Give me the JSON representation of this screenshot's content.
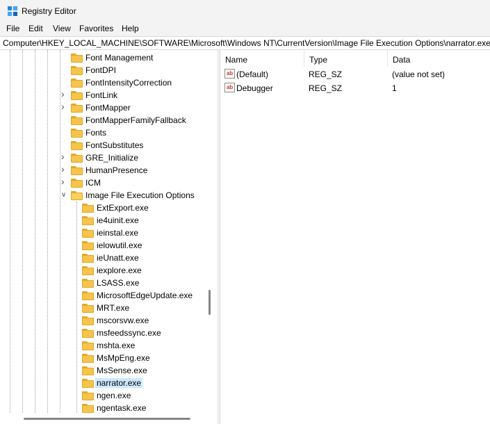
{
  "window": {
    "title": "Registry Editor",
    "app_icon": "regedit-icon"
  },
  "menu": [
    "File",
    "Edit",
    "View",
    "Favorites",
    "Help"
  ],
  "address": "Computer\\HKEY_LOCAL_MACHINE\\SOFTWARE\\Microsoft\\Windows NT\\CurrentVersion\\Image File Execution Options\\narrator.exe",
  "tree": {
    "items": [
      {
        "label": "Font Management",
        "level": 1,
        "expandable": false
      },
      {
        "label": "FontDPI",
        "level": 1,
        "expandable": false
      },
      {
        "label": "FontIntensityCorrection",
        "level": 1,
        "expandable": false
      },
      {
        "label": "FontLink",
        "level": 1,
        "expandable": true
      },
      {
        "label": "FontMapper",
        "level": 1,
        "expandable": true
      },
      {
        "label": "FontMapperFamilyFallback",
        "level": 1,
        "expandable": false
      },
      {
        "label": "Fonts",
        "level": 1,
        "expandable": false
      },
      {
        "label": "FontSubstitutes",
        "level": 1,
        "expandable": false
      },
      {
        "label": "GRE_Initialize",
        "level": 1,
        "expandable": true
      },
      {
        "label": "HumanPresence",
        "level": 1,
        "expandable": true
      },
      {
        "label": "ICM",
        "level": 1,
        "expandable": true
      },
      {
        "label": "Image File Execution Options",
        "level": 1,
        "expandable": true,
        "expanded": true
      },
      {
        "label": "ExtExport.exe",
        "level": 2,
        "expandable": false
      },
      {
        "label": "ie4uinit.exe",
        "level": 2,
        "expandable": false
      },
      {
        "label": "ieinstal.exe",
        "level": 2,
        "expandable": false
      },
      {
        "label": "ielowutil.exe",
        "level": 2,
        "expandable": false
      },
      {
        "label": "ieUnatt.exe",
        "level": 2,
        "expandable": false
      },
      {
        "label": "iexplore.exe",
        "level": 2,
        "expandable": false
      },
      {
        "label": "LSASS.exe",
        "level": 2,
        "expandable": false
      },
      {
        "label": "MicrosoftEdgeUpdate.exe",
        "level": 2,
        "expandable": false
      },
      {
        "label": "MRT.exe",
        "level": 2,
        "expandable": false
      },
      {
        "label": "mscorsvw.exe",
        "level": 2,
        "expandable": false
      },
      {
        "label": "msfeedssync.exe",
        "level": 2,
        "expandable": false
      },
      {
        "label": "mshta.exe",
        "level": 2,
        "expandable": false
      },
      {
        "label": "MsMpEng.exe",
        "level": 2,
        "expandable": false
      },
      {
        "label": "MsSense.exe",
        "level": 2,
        "expandable": false
      },
      {
        "label": "narrator.exe",
        "level": 2,
        "expandable": false,
        "selected": true
      },
      {
        "label": "ngen.exe",
        "level": 2,
        "expandable": false
      },
      {
        "label": "ngentask.exe",
        "level": 2,
        "expandable": false
      }
    ]
  },
  "list": {
    "columns": [
      "Name",
      "Type",
      "Data"
    ],
    "rows": [
      {
        "name": "(Default)",
        "type": "REG_SZ",
        "data": "(value not set)",
        "icon": "string-value-icon"
      },
      {
        "name": "Debugger",
        "type": "REG_SZ",
        "data": "1",
        "icon": "string-value-icon"
      }
    ]
  },
  "colors": {
    "selection": "#cce8ff",
    "folder": "#f6c44a",
    "chrome": "#f3f3f3"
  }
}
